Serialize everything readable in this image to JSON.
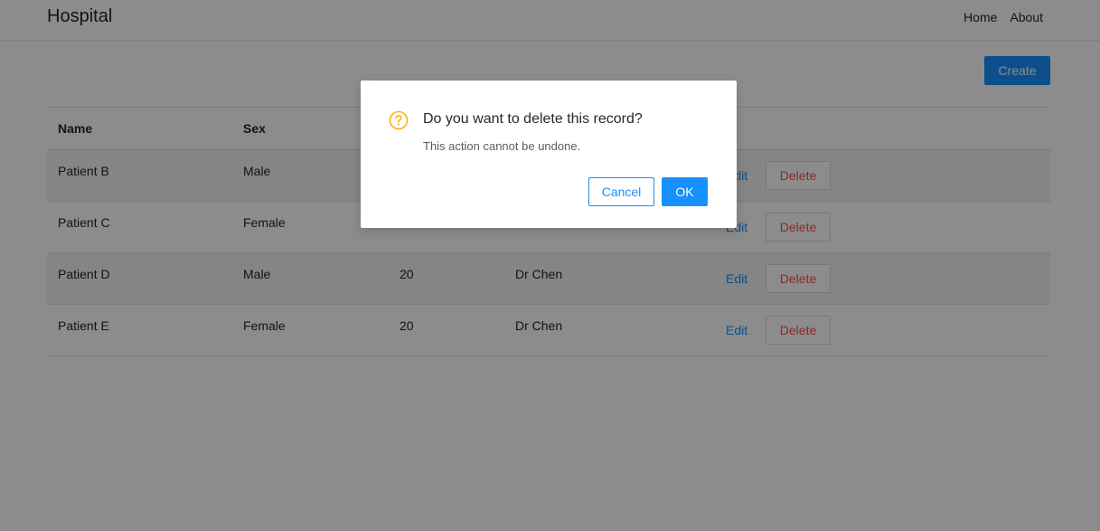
{
  "navbar": {
    "brand": "Hospital",
    "links": [
      "Home",
      "About"
    ]
  },
  "toolbar": {
    "create_label": "Create"
  },
  "table": {
    "headers": [
      "Name",
      "Sex",
      "",
      "",
      ""
    ],
    "rows": [
      {
        "name": "Patient B",
        "sex": "Male",
        "age": "",
        "doctor": "",
        "edit": "Edit",
        "delete": "Delete"
      },
      {
        "name": "Patient C",
        "sex": "Female",
        "age": "",
        "doctor": "",
        "edit": "Edit",
        "delete": "Delete"
      },
      {
        "name": "Patient D",
        "sex": "Male",
        "age": "20",
        "doctor": "Dr Chen",
        "edit": "Edit",
        "delete": "Delete"
      },
      {
        "name": "Patient E",
        "sex": "Female",
        "age": "20",
        "doctor": "Dr Chen",
        "edit": "Edit",
        "delete": "Delete"
      }
    ]
  },
  "modal": {
    "icon": "question-circle-icon",
    "title": "Do you want to delete this record?",
    "content": "This action cannot be undone.",
    "cancel_label": "Cancel",
    "ok_label": "OK"
  },
  "colors": {
    "primary": "#1890ff",
    "danger": "#ff4d4f",
    "warning": "#faad14"
  }
}
